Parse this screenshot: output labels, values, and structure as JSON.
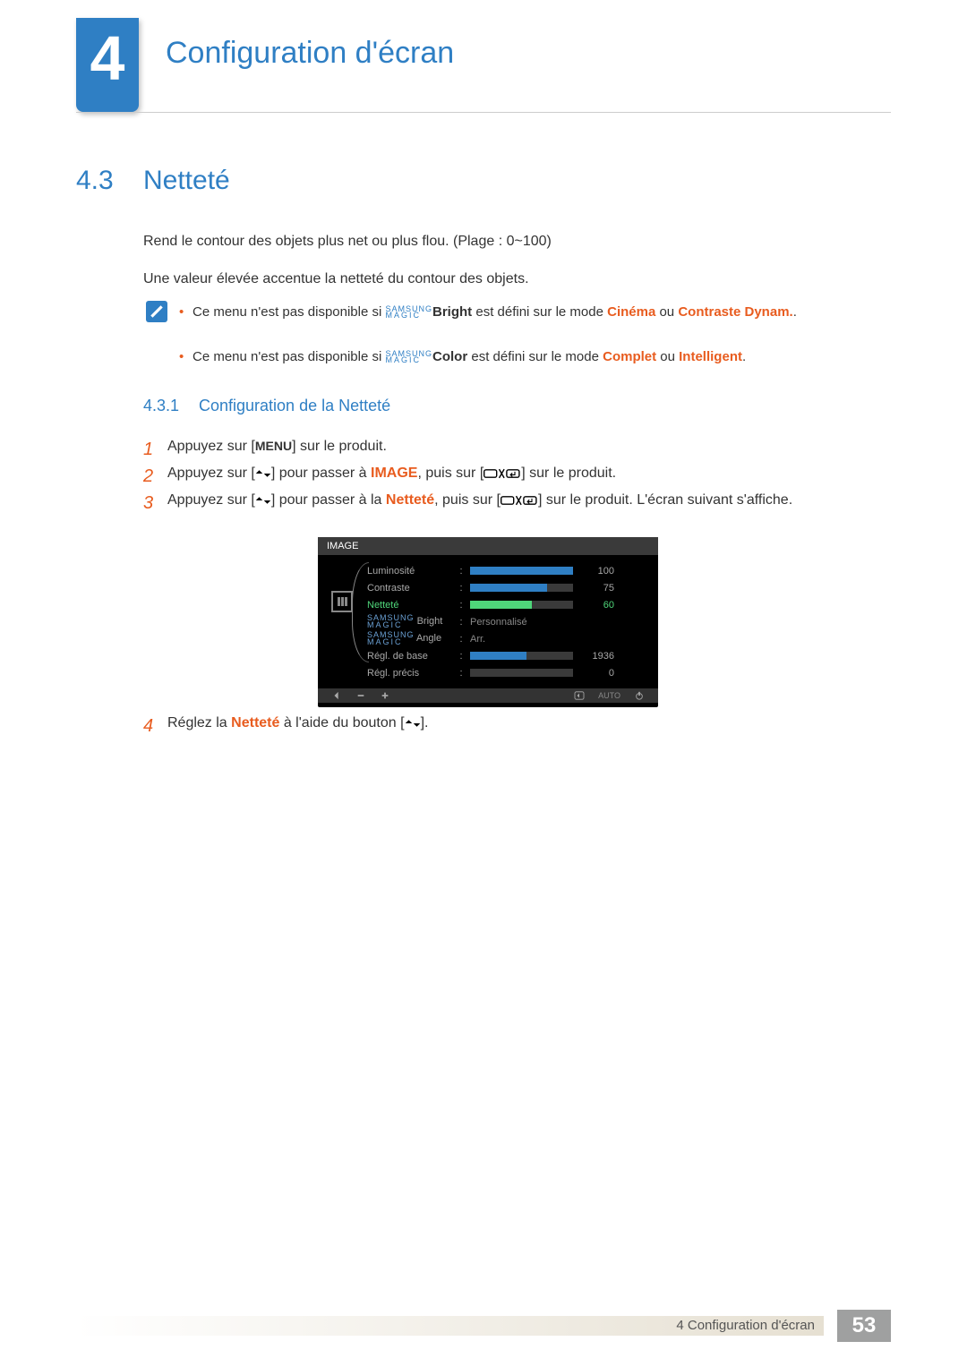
{
  "chapter": {
    "number": "4",
    "title": "Configuration d'écran"
  },
  "section": {
    "number": "4.3",
    "title": "Netteté"
  },
  "para1": "Rend le contour des objets plus net ou plus flou. (Plage : 0~100)",
  "para2": "Une valeur élevée accentue la netteté du contour des objets.",
  "magic": {
    "line1": "SAMSUNG",
    "line2": "MAGIC"
  },
  "note1": {
    "pre": "Ce menu n'est pas disponible si ",
    "bold1": "Bright",
    "mid": " est défini sur le mode ",
    "o1": "Cinéma",
    "or": " ou ",
    "o2": "Contraste Dynam.",
    "end": "."
  },
  "note2": {
    "pre": "Ce menu n'est pas disponible si ",
    "bold1": "Color",
    "mid": " est défini sur le mode ",
    "o1": "Complet",
    "or": " ou ",
    "o2": "Intelligent",
    "end": "."
  },
  "subsection": {
    "number": "4.3.1",
    "title": "Configuration de la Netteté"
  },
  "steps": {
    "s1": {
      "n": "1",
      "pre": "Appuyez sur [",
      "key": "MENU",
      "post": "] sur le produit."
    },
    "s2": {
      "n": "2",
      "pre": "Appuyez sur [",
      "mid": "] pour passer à ",
      "target": "IMAGE",
      "mid2": ", puis sur [",
      "post": "] sur le produit."
    },
    "s3": {
      "n": "3",
      "pre": "Appuyez sur [",
      "mid": "] pour passer à la ",
      "target": "Netteté",
      "mid2": ", puis sur [",
      "post": "] sur le produit. L'écran suivant s'affiche."
    },
    "s4": {
      "n": "4",
      "pre": "Réglez la ",
      "target": "Netteté",
      "mid": " à l'aide du bouton [",
      "post": "]."
    }
  },
  "osd": {
    "title": "IMAGE",
    "rows": [
      {
        "label": "Luminosité",
        "type": "bar",
        "pct": 100,
        "val": "100"
      },
      {
        "label": "Contraste",
        "type": "bar",
        "pct": 75,
        "val": "75"
      },
      {
        "label": "Netteté",
        "type": "bar",
        "pct": 60,
        "val": "60",
        "hl": true
      },
      {
        "label_magic": true,
        "suffix": " Bright",
        "type": "text",
        "val": "Personnalisé"
      },
      {
        "label_magic": true,
        "suffix": " Angle",
        "type": "text",
        "val": "Arr."
      },
      {
        "label": "Régl. de base",
        "type": "bar",
        "pct": 55,
        "val": "1936"
      },
      {
        "label": "Régl. précis",
        "type": "bar",
        "pct": 0,
        "val": "0"
      }
    ],
    "auto": "AUTO"
  },
  "footer": {
    "text": "4 Configuration d'écran",
    "page": "53"
  }
}
